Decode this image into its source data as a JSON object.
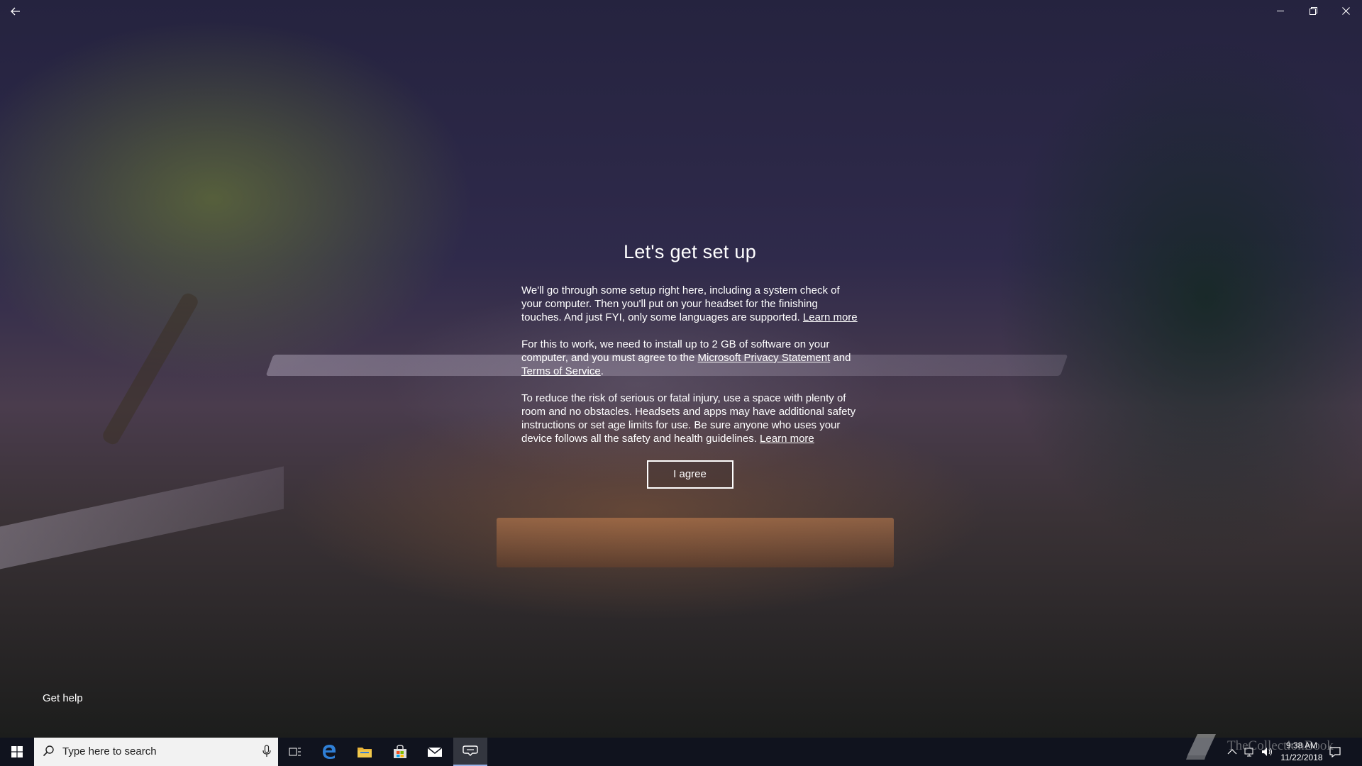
{
  "title_bar": {
    "back_icon": "back-arrow-icon",
    "minimize_icon": "minimize-icon",
    "maximize_icon": "restore-icon",
    "close_icon": "close-icon"
  },
  "setup": {
    "title": "Let's get set up",
    "para1_text": "We'll go through some setup right here, including a system check of your computer. Then you'll put on your headset for the finishing touches. And just FYI, only some languages are supported.",
    "para1_link": "Learn more",
    "para2_text1": "For this to work, we need to install up to 2 GB of software on your computer, and you must agree to the",
    "para2_link1": "Microsoft Privacy Statement",
    "para2_text2": "and",
    "para2_link2": "Terms of Service",
    "para2_text3": ".",
    "para3_text": "To reduce the risk of serious or fatal injury, use a space with plenty of room and no obstacles. Headsets and apps may have additional safety instructions or set age limits for use. Be sure anyone who uses your device follows all the safety and health guidelines.",
    "para3_link": "Learn more",
    "agree_label": "I agree"
  },
  "footer": {
    "get_help": "Get help"
  },
  "taskbar": {
    "search_placeholder": "Type here to search",
    "time": "9:38 AM",
    "date": "11/22/2018",
    "watermark": "TheCollectionBook",
    "accent": "#10131e"
  }
}
